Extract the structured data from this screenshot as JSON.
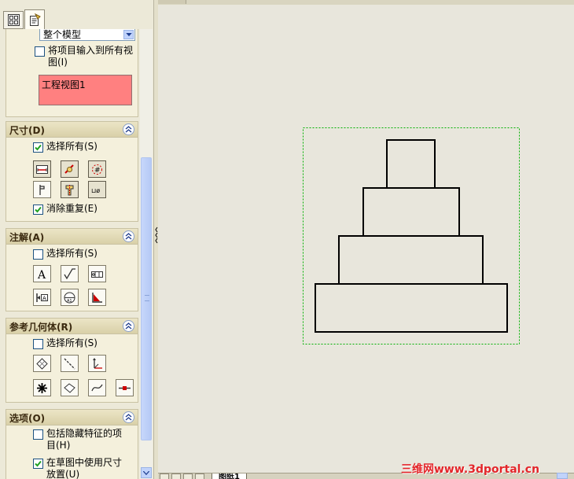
{
  "tabs": [
    {
      "name": "feature-manager-tab",
      "icon": "feature-tree-icon"
    },
    {
      "name": "property-manager-tab",
      "icon": "property-manager-icon",
      "active": true
    }
  ],
  "import_section": {
    "scope_dropdown": "整个模型",
    "import_all_views_label": "将项目输入到所有视",
    "import_all_views_label_2": "图(I)",
    "views_list": [
      "工程视图1"
    ]
  },
  "dimensions": {
    "title": "尺寸(D)",
    "select_all_label": "选择所有(S)",
    "select_all_checked": true,
    "icons": [
      "marked-for-drawing-icon",
      "not-marked-for-drawing-icon",
      "instance-count-icon",
      "tolerance-icon",
      "hole-wizard-profile-icon",
      "hole-callout-icon"
    ],
    "eliminate_duplicates_label": "消除重复(E)",
    "eliminate_duplicates_checked": true
  },
  "annotations": {
    "title": "注解(A)",
    "select_all_label": "选择所有(S)",
    "select_all_checked": false,
    "icons": [
      "note-icon",
      "surface-finish-icon",
      "geometric-tolerance-icon",
      "datum-feature-icon",
      "datum-target-icon",
      "weld-symbol-icon"
    ]
  },
  "reference_geometry": {
    "title": "参考几何体(R)",
    "select_all_label": "选择所有(S)",
    "select_all_checked": false,
    "icons": [
      "plane-icon",
      "axis-icon",
      "coordinate-system-icon",
      "origin-icon",
      "point-icon",
      "surface-icon",
      "curve-icon",
      "route-point-icon"
    ]
  },
  "options": {
    "title": "选项(O)",
    "include_hidden_label": "包括隐藏特征的项",
    "include_hidden_label_2": "目(H)",
    "include_hidden_checked": false,
    "use_sketch_dims_label": "在草图中使用尺寸",
    "use_sketch_dims_label_2": "放置(U)",
    "use_sketch_dims_checked": true
  },
  "bottom": {
    "sheet_tab": "图纸1",
    "watermark": "三维网www.3dportal.cn"
  },
  "colors": {
    "view_list_bg": "#ff8080",
    "view_boundary": "#00b000",
    "accent_blue": "#316ac5"
  }
}
